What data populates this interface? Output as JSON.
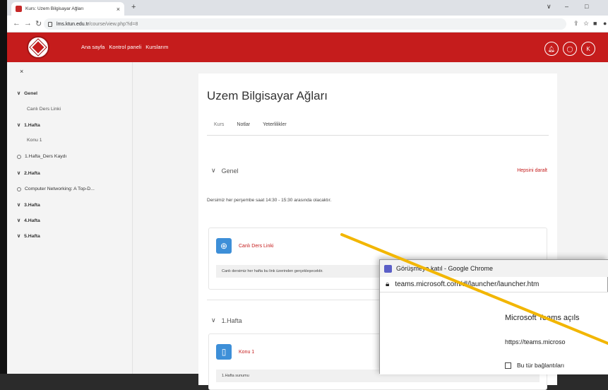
{
  "browser": {
    "tab_title": "Kurs: Uzem Bilgisayar Ağları",
    "tab_close": "×",
    "new_tab": "+",
    "url_host": "lms.ktun.edu.tr",
    "url_path": "/course/view.php?id=8",
    "min": "–",
    "max": "□",
    "chev": "∨"
  },
  "header": {
    "nav": [
      "Ana sayfa",
      "Kontrol paneli",
      "Kurslarım"
    ],
    "user_initial": "K"
  },
  "sidebar": {
    "close": "×",
    "items": [
      {
        "label": "Genel",
        "type": "section"
      },
      {
        "label": "Canlı Ders Linki",
        "type": "sub"
      },
      {
        "label": "1.Hafta",
        "type": "section"
      },
      {
        "label": "Konu 1",
        "type": "sub"
      },
      {
        "label": "1.Hafta_Ders Kaydı",
        "type": "circle"
      },
      {
        "label": "2.Hafta",
        "type": "section"
      },
      {
        "label": "Computer Networking: A Top-D...",
        "type": "circle"
      },
      {
        "label": "3.Hafta",
        "type": "section"
      },
      {
        "label": "4.Hafta",
        "type": "section"
      },
      {
        "label": "5.Hafta",
        "type": "section"
      }
    ]
  },
  "course": {
    "title": "Uzem Bilgisayar Ağları",
    "tabs": [
      "Kurs",
      "Notlar",
      "Yeterlilikler"
    ],
    "section_general": "Genel",
    "collapse_all": "Hepsini daralt",
    "description": "Dersimiz her perşembe saat 14:30 - 15:30 arasında olacaktır.",
    "activity1_title": "Canlı Ders Linki",
    "activity1_desc": "Canlı dersimiz her hafta bu link üzerinden gerçekleşecektir.",
    "section_week1": "1.Hafta",
    "activity2_title": "Konu 1",
    "activity2_desc": "1.Hafta sunumu"
  },
  "popup": {
    "title": "Görüşmeye katıl - Google Chrome",
    "url": "teams.microsoft.com/dl/launcher/launcher.htm",
    "dialog_title": "Microsoft Teams açıls",
    "dialog_url": "https://teams.microso",
    "checkbox_label": "Bu tür bağlantıları"
  },
  "colors": {
    "brand_red": "#c51c1c",
    "activity_blue": "#3d8fd8",
    "annotation_yellow": "#f2b600"
  }
}
